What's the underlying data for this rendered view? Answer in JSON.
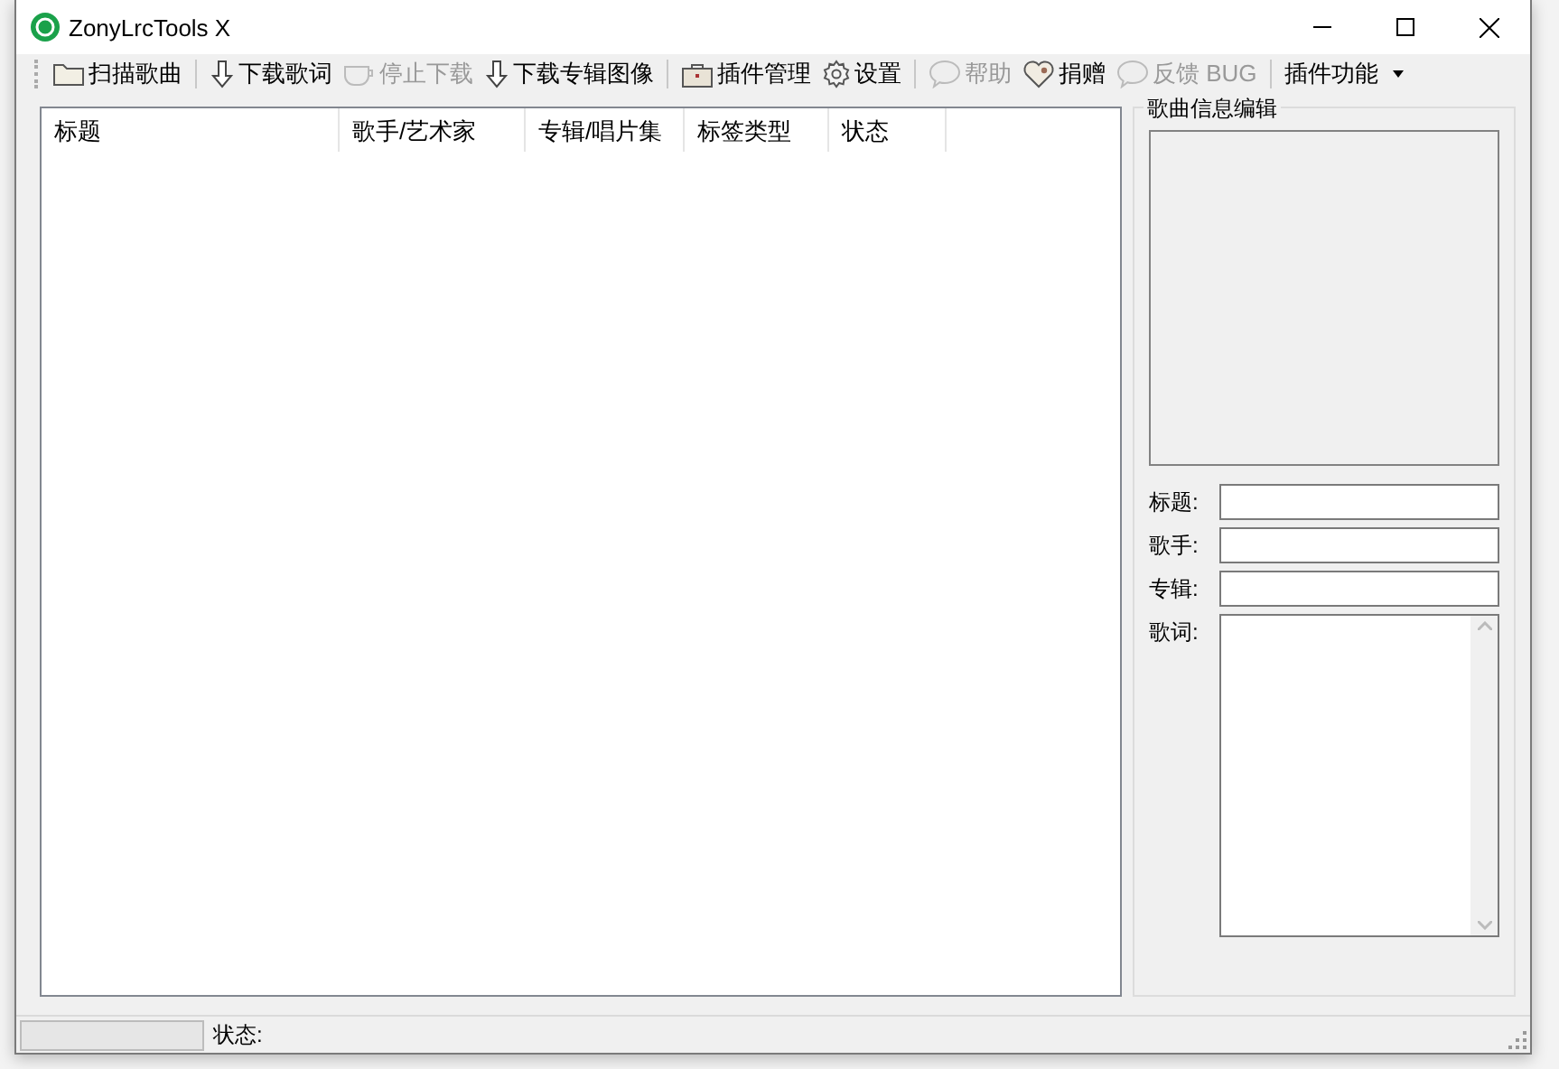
{
  "window": {
    "title": "ZonyLrcTools X"
  },
  "toolbar": [
    {
      "kind": "button",
      "label": "扫描歌曲",
      "disabled": false
    },
    {
      "kind": "separator"
    },
    {
      "kind": "button",
      "label": "下载歌词",
      "disabled": false
    },
    {
      "kind": "button",
      "label": "停止下载",
      "disabled": true
    },
    {
      "kind": "button",
      "label": "下载专辑图像",
      "disabled": false
    },
    {
      "kind": "separator"
    },
    {
      "kind": "button",
      "label": "插件管理",
      "disabled": false
    },
    {
      "kind": "button",
      "label": "设置",
      "disabled": false
    },
    {
      "kind": "separator"
    },
    {
      "kind": "button",
      "label": "帮助",
      "disabled": true
    },
    {
      "kind": "button",
      "label": "捐赠",
      "disabled": false
    },
    {
      "kind": "button",
      "label": "反馈 BUG",
      "disabled": true
    },
    {
      "kind": "separator"
    },
    {
      "kind": "dropdown",
      "label": "插件功能",
      "disabled": false
    }
  ],
  "song_list": {
    "columns": [
      "标题",
      "歌手/艺术家",
      "专辑/唱片集",
      "标签类型",
      "状态"
    ]
  },
  "info_panel": {
    "title": "歌曲信息编辑",
    "fields": [
      {
        "kind": "line",
        "label": "标题:"
      },
      {
        "kind": "line",
        "label": "歌手:"
      },
      {
        "kind": "line",
        "label": "专辑:"
      },
      {
        "kind": "multiline",
        "label": "歌词:"
      }
    ]
  },
  "status_bar": {
    "progress": {
      "level": 0
    },
    "label": "状态:"
  }
}
